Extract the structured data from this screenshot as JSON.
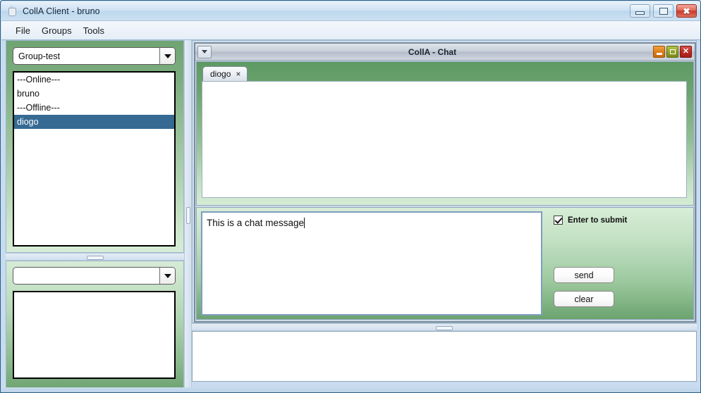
{
  "window": {
    "title": "CollA Client - bruno",
    "icon": "java-coffee-cup-icon",
    "controls": {
      "minimize": "minimize-icon",
      "maximize": "maximize-icon",
      "close": "close-icon",
      "close_glyph": "✖"
    }
  },
  "menubar": {
    "items": [
      {
        "label": "File"
      },
      {
        "label": "Groups"
      },
      {
        "label": "Tools"
      }
    ]
  },
  "sidebar": {
    "group_combo": {
      "value": "Group-test",
      "placeholder": "",
      "arrow_icon": "chevron-down-icon"
    },
    "contacts": [
      {
        "label": "---Online---",
        "selected": false
      },
      {
        "label": "bruno",
        "selected": false
      },
      {
        "label": "---Offline---",
        "selected": false
      },
      {
        "label": "diogo",
        "selected": true
      }
    ],
    "secondary_combo": {
      "value": "",
      "placeholder": "",
      "arrow_icon": "chevron-down-icon"
    },
    "secondary_list": []
  },
  "chat_frame": {
    "title": "CollA - Chat",
    "menu_button_icon": "chevron-down-icon",
    "controls": {
      "minimize": "minimize-icon",
      "maximize": "restore-icon",
      "close": "close-icon",
      "close_glyph": "✕"
    },
    "tabs": [
      {
        "label": "diogo",
        "close_glyph": "×",
        "active": true
      }
    ],
    "transcript": "",
    "input": {
      "value": "This is a chat message",
      "placeholder": ""
    },
    "enter_to_submit": {
      "label": "Enter to submit",
      "checked": true
    },
    "buttons": {
      "send": "send",
      "clear": "clear"
    }
  },
  "log_panel": {
    "content": ""
  },
  "colors": {
    "accent_green": "#5e9a63",
    "panel_light_green": "#d5ecd5",
    "selection_blue": "#366a93",
    "chrome_blue": "#cfe0f2",
    "close_red": "#c8392a",
    "minimize_orange": "#de7e18",
    "maximize_olive": "#92a228"
  }
}
